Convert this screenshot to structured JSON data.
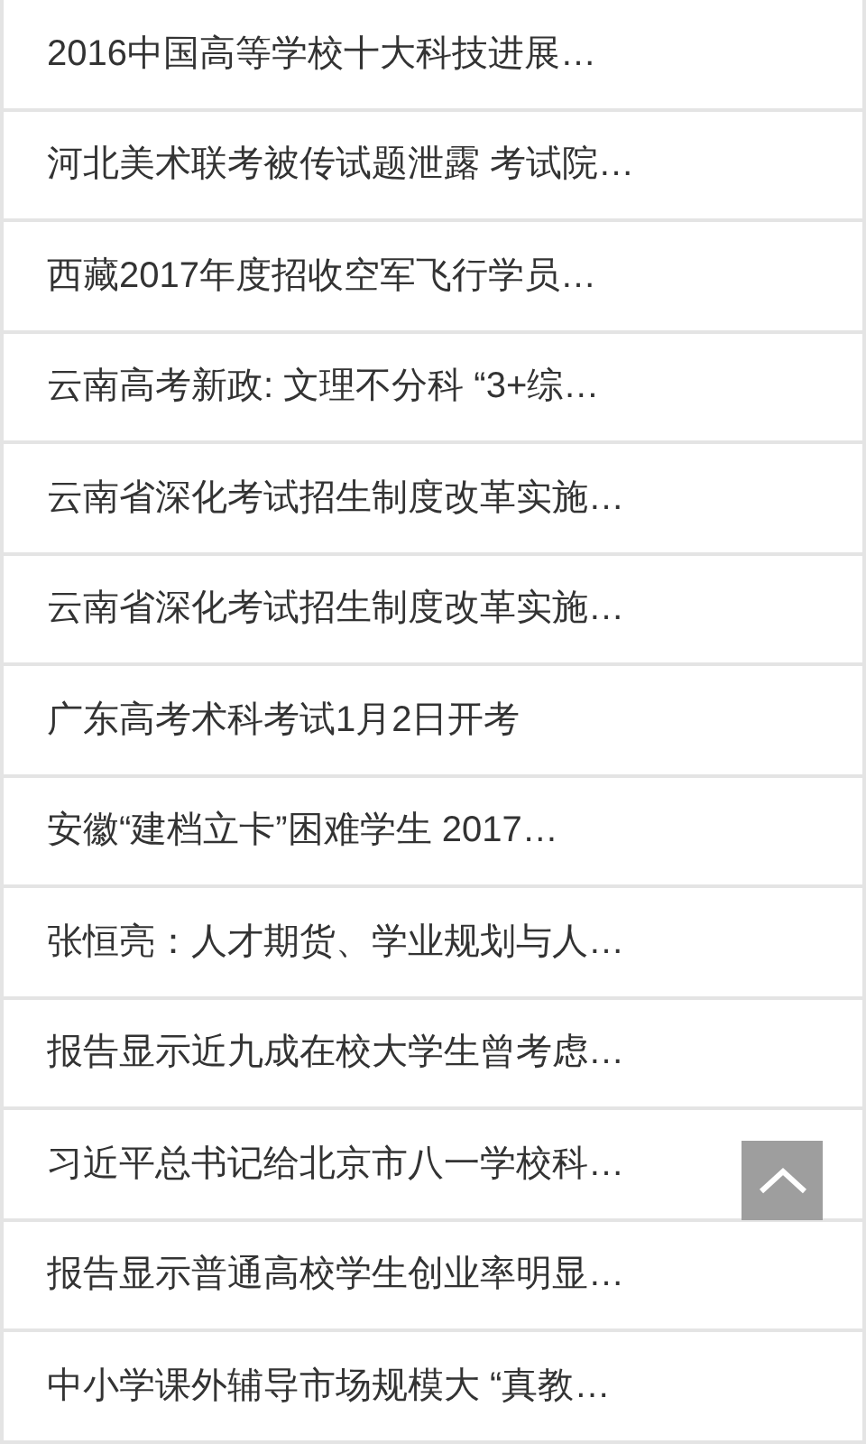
{
  "news_items": [
    {
      "title": "2016中国高等学校十大科技进展…"
    },
    {
      "title": "河北美术联考被传试题泄露 考试院…"
    },
    {
      "title": "西藏2017年度招收空军飞行学员…"
    },
    {
      "title": "云南高考新政: 文理不分科 “3+综…"
    },
    {
      "title": "云南省深化考试招生制度改革实施…"
    },
    {
      "title": "云南省深化考试招生制度改革实施…"
    },
    {
      "title": "广东高考术科考试1月2日开考"
    },
    {
      "title": "安徽“建档立卡”困难学生 2017…"
    },
    {
      "title": "张恒亮：人才期货、学业规划与人…"
    },
    {
      "title": "报告显示近九成在校大学生曾考虑…"
    },
    {
      "title": "习近平总书记给北京市八一学校科…"
    },
    {
      "title": "报告显示普通高校学生创业率明显…"
    },
    {
      "title": "中小学课外辅导市场规模大 “真教…"
    }
  ]
}
